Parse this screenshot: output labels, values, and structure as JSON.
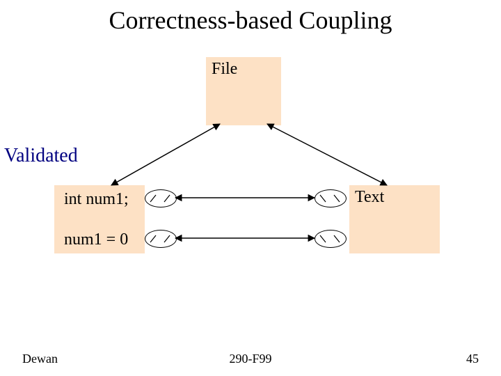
{
  "title": "Correctness-based Coupling",
  "validated_label": "Validated",
  "file_label": "File",
  "text_label": "Text",
  "code_line1": "int num1;",
  "code_line2": "num1 = 0",
  "footer": {
    "author": "Dewan",
    "course": "290-F99",
    "page": "45"
  },
  "chart_data": {
    "type": "diagram",
    "title": "Correctness-based Coupling",
    "nodes": [
      {
        "id": "file",
        "label": "File"
      },
      {
        "id": "validated",
        "label": "Validated"
      },
      {
        "id": "left_replica",
        "label": "int num1; / num1 = 0"
      },
      {
        "id": "right_replica",
        "label": "Text"
      }
    ],
    "edges": [
      {
        "from": "file",
        "to": "left_replica",
        "bidirectional": true
      },
      {
        "from": "file",
        "to": "right_replica",
        "bidirectional": true
      },
      {
        "from": "left_replica",
        "to": "right_replica",
        "row": 1,
        "bidirectional": true
      },
      {
        "from": "left_replica",
        "to": "right_replica",
        "row": 2,
        "bidirectional": true
      }
    ],
    "annotation": "Validated"
  }
}
